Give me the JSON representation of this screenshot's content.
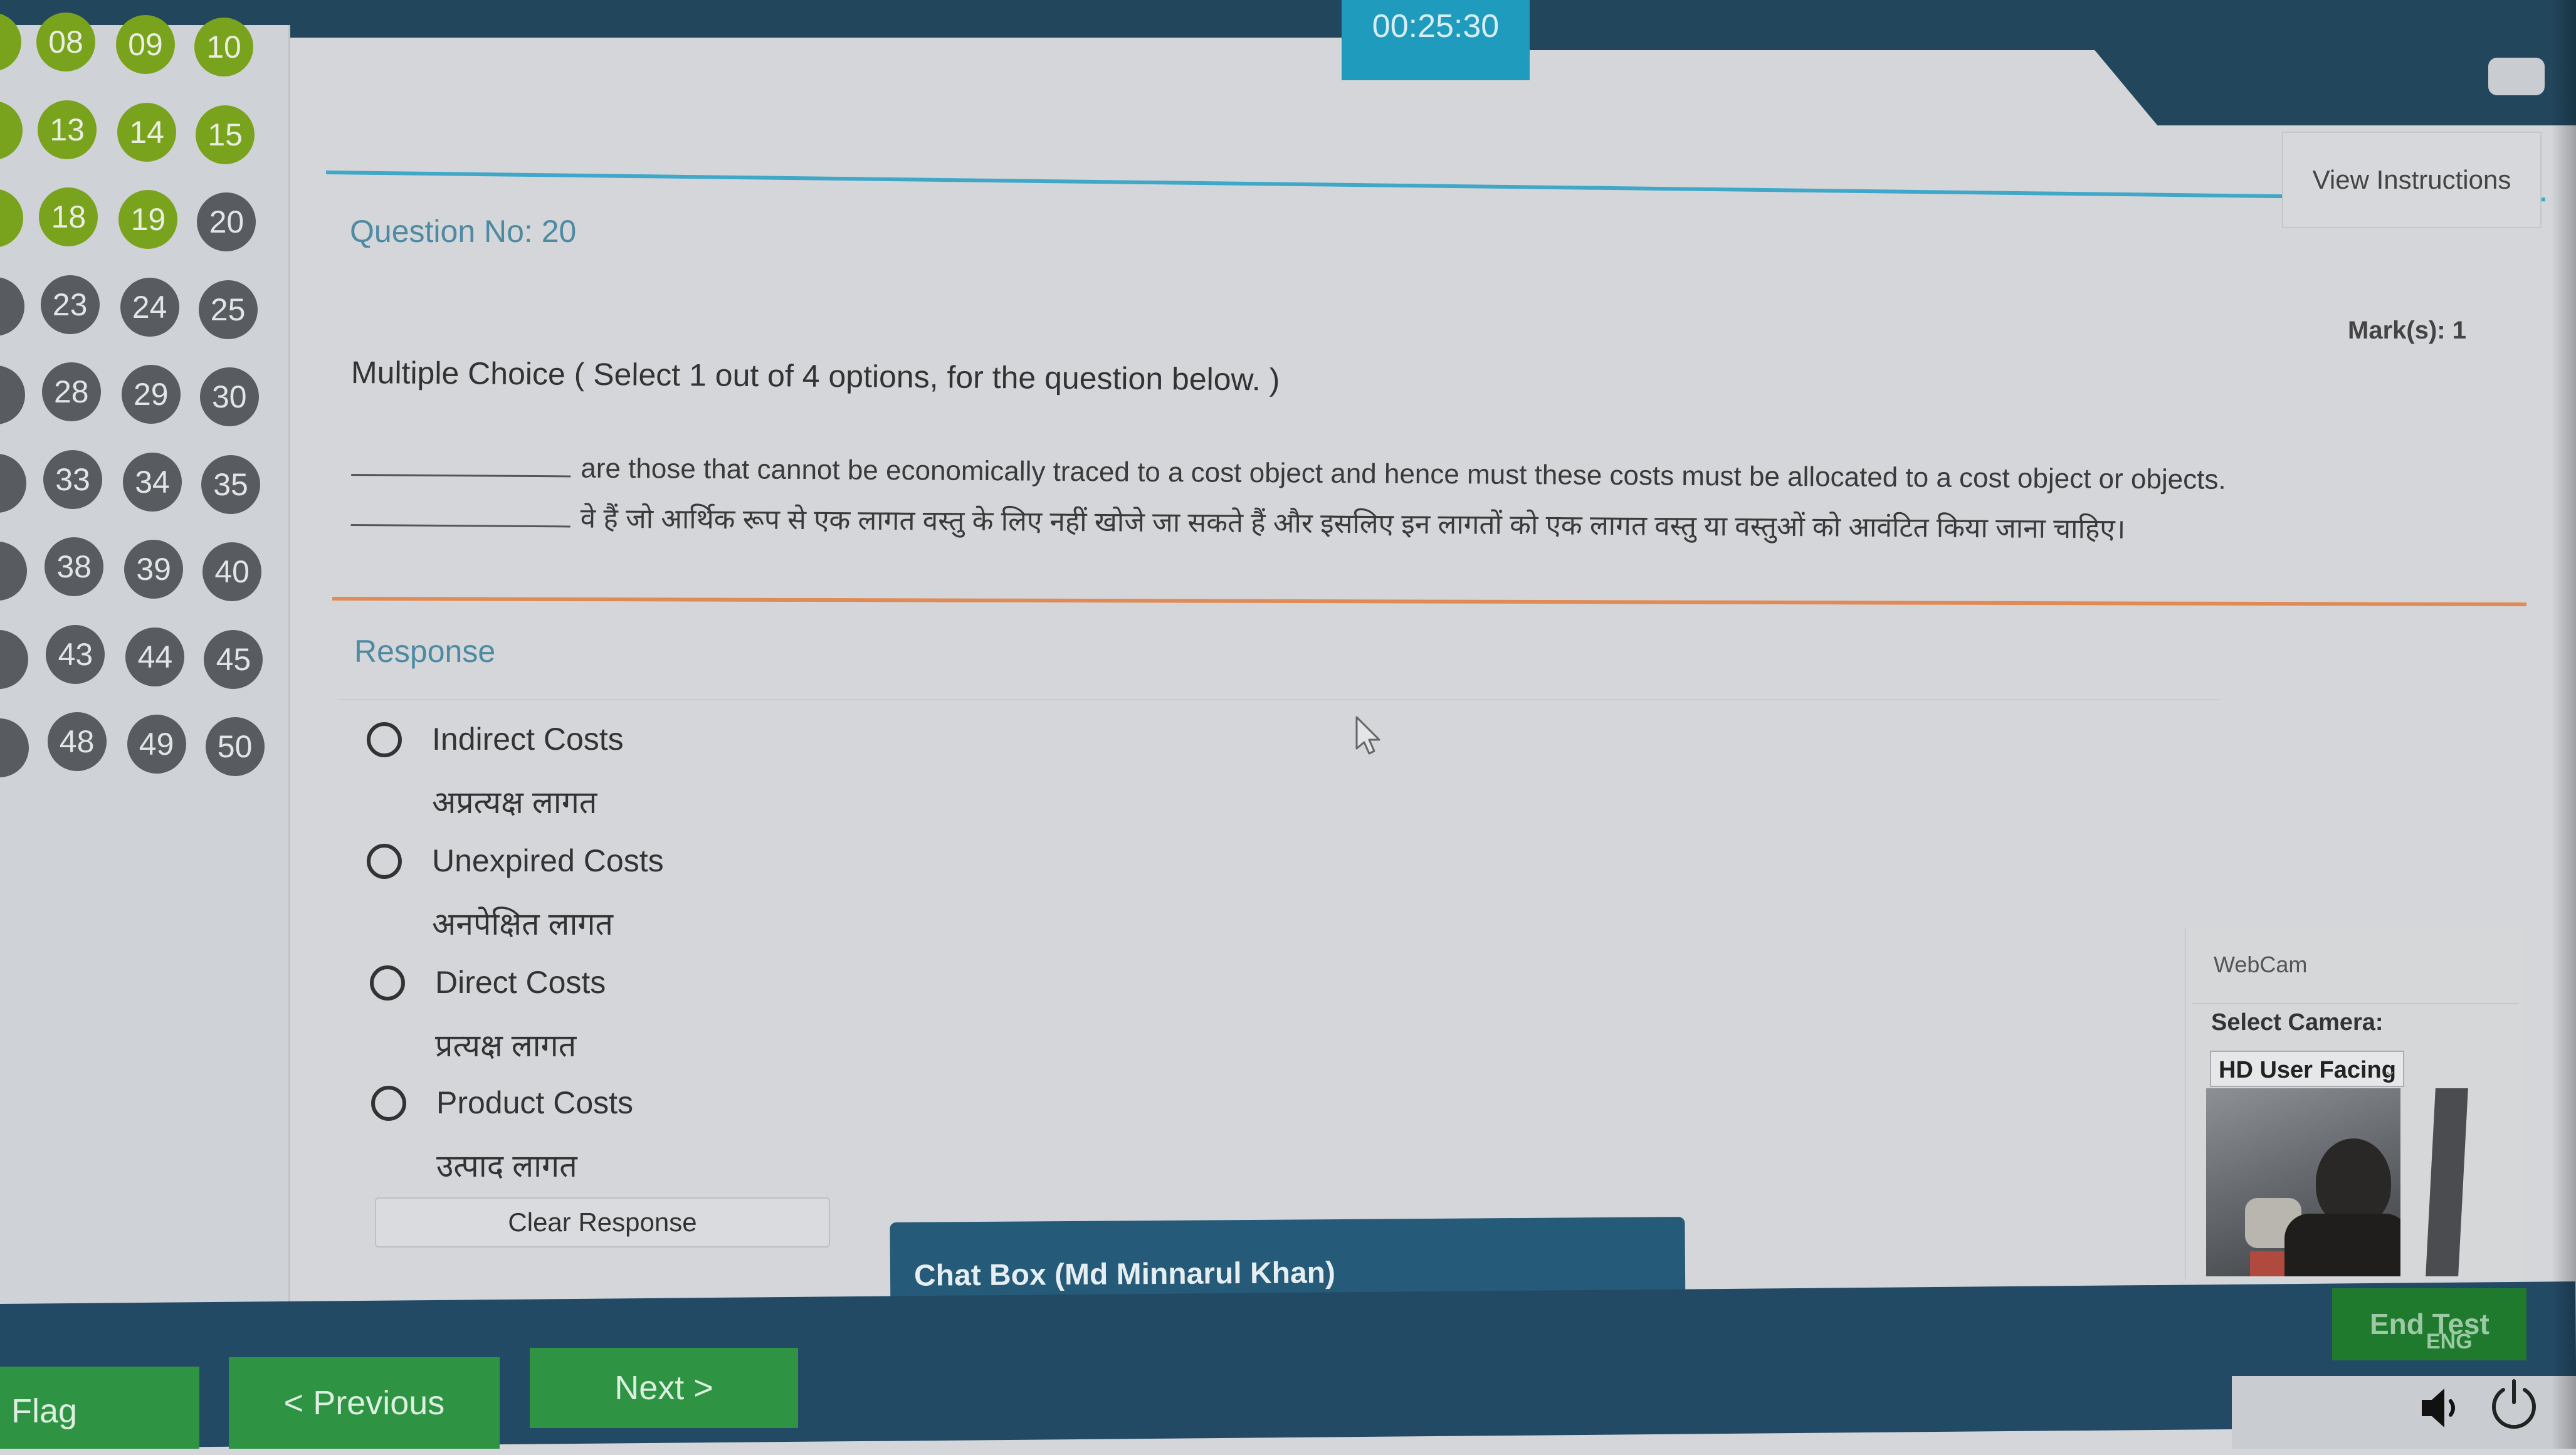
{
  "header": {
    "timer": "00:25:30",
    "view_instructions_label": "View Instructions"
  },
  "palette": {
    "answered": "#7aa31d",
    "unvisited": "#585b60",
    "header_bg": "#22465c",
    "timer_bg": "#1e9bbd",
    "nav_green": "#2e9443",
    "accent_blue": "#3fa7c8",
    "accent_orange": "#e08a55"
  },
  "question_palette": {
    "rows": [
      [
        {
          "n": "08",
          "status": "answered"
        },
        {
          "n": "09",
          "status": "answered"
        },
        {
          "n": "10",
          "status": "answered"
        }
      ],
      [
        {
          "n": "13",
          "status": "answered"
        },
        {
          "n": "14",
          "status": "answered"
        },
        {
          "n": "15",
          "status": "answered"
        }
      ],
      [
        {
          "n": "18",
          "status": "answered"
        },
        {
          "n": "19",
          "status": "answered"
        },
        {
          "n": "20",
          "status": "current"
        }
      ],
      [
        {
          "n": "23",
          "status": "unvisited"
        },
        {
          "n": "24",
          "status": "unvisited"
        },
        {
          "n": "25",
          "status": "unvisited"
        }
      ],
      [
        {
          "n": "28",
          "status": "unvisited"
        },
        {
          "n": "29",
          "status": "unvisited"
        },
        {
          "n": "30",
          "status": "unvisited"
        }
      ],
      [
        {
          "n": "33",
          "status": "unvisited"
        },
        {
          "n": "34",
          "status": "unvisited"
        },
        {
          "n": "35",
          "status": "unvisited"
        }
      ],
      [
        {
          "n": "38",
          "status": "unvisited"
        },
        {
          "n": "39",
          "status": "unvisited"
        },
        {
          "n": "40",
          "status": "unvisited"
        }
      ],
      [
        {
          "n": "43",
          "status": "unvisited"
        },
        {
          "n": "44",
          "status": "unvisited"
        },
        {
          "n": "45",
          "status": "unvisited"
        }
      ],
      [
        {
          "n": "48",
          "status": "unvisited"
        },
        {
          "n": "49",
          "status": "unvisited"
        },
        {
          "n": "50",
          "status": "unvisited"
        }
      ]
    ]
  },
  "question": {
    "number_label": "Question No: 20",
    "marks_label": "Mark(s): 1",
    "type_label": "Multiple Choice ( Select 1 out of 4 options, for the question below. )",
    "text_en": "are those that cannot be economically traced to a cost object and hence must these costs must be allocated to a cost object or objects.",
    "text_hi": "वे हैं जो आर्थिक रूप से एक लागत वस्तु के लिए नहीं खोजे जा सकते हैं और इसलिए इन लागतों को एक लागत वस्तु या वस्तुओं को आवंटित किया जाना चाहिए।"
  },
  "response": {
    "label": "Response",
    "options": [
      {
        "en": "Indirect Costs",
        "hi": "अप्रत्यक्ष लागत",
        "selected": false
      },
      {
        "en": "Unexpired Costs",
        "hi": "अनपेक्षित लागत",
        "selected": false
      },
      {
        "en": "Direct Costs",
        "hi": "प्रत्यक्ष लागत",
        "selected": false
      },
      {
        "en": "Product Costs",
        "hi": "उत्पाद लागत",
        "selected": false
      }
    ],
    "clear_label": "Clear Response"
  },
  "webcam": {
    "title": "WebCam",
    "select_label": "Select Camera:",
    "selected_camera": "HD User Facing"
  },
  "chat": {
    "title": "Chat Box (Md Minnarul Khan)"
  },
  "footer": {
    "flag_label": "Flag",
    "previous_label": "< Previous",
    "next_label": "Next >",
    "end_test_label": "End Test",
    "language_label": "ENG"
  }
}
